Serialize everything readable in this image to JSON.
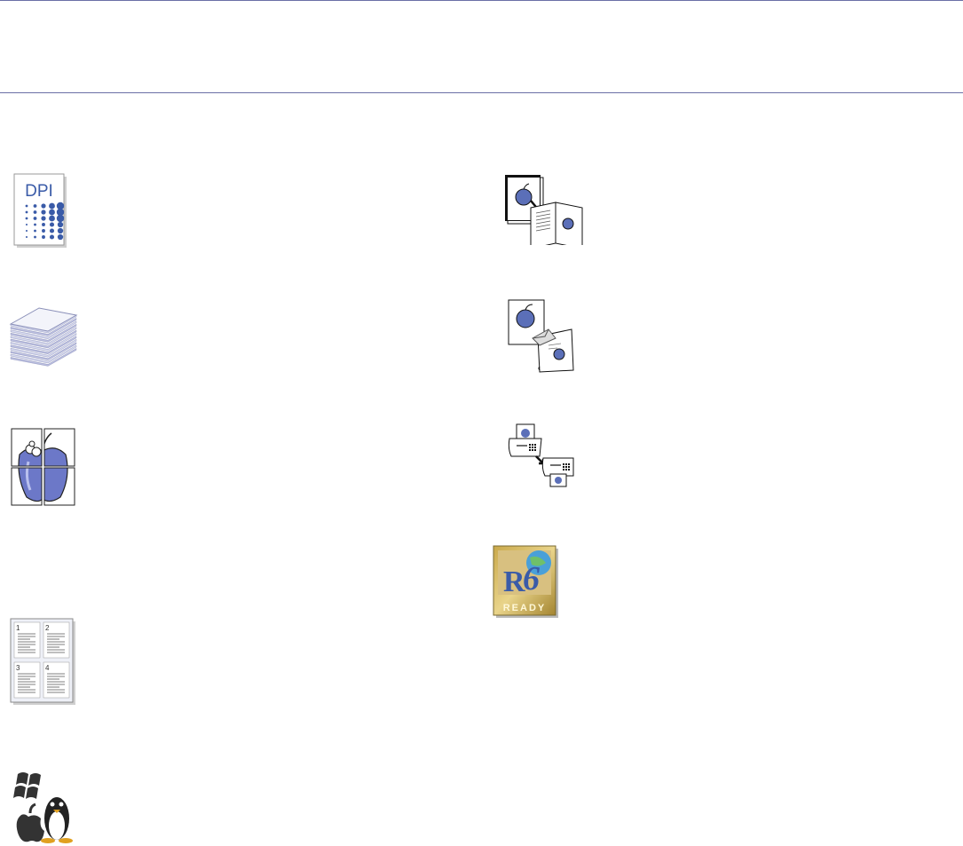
{
  "header": {
    "title": ""
  },
  "features": {
    "high_resolution": {
      "icon": "dpi-icon",
      "icon_text": "DPI"
    },
    "paper_stack": {
      "icon": "paper-stack-icon"
    },
    "poster_print": {
      "icon": "poster-apple-icon"
    },
    "n_up_print": {
      "icon": "n-up-pages-icon",
      "page_numbers": [
        "1",
        "2",
        "3",
        "4"
      ]
    },
    "os_support": {
      "icon": "windows-mac-linux-icon"
    },
    "booklet_print": {
      "icon": "booklet-print-icon"
    },
    "scan_to_email": {
      "icon": "scan-to-email-icon"
    },
    "fax": {
      "icon": "fax-icon"
    },
    "ipv6": {
      "icon": "ipv6-ready-icon",
      "badge_text": "READY"
    }
  },
  "colors": {
    "accent_blue": "#5b6fb8",
    "rule": "#6b6fa6",
    "dpi_text": "#3a5ba8"
  }
}
